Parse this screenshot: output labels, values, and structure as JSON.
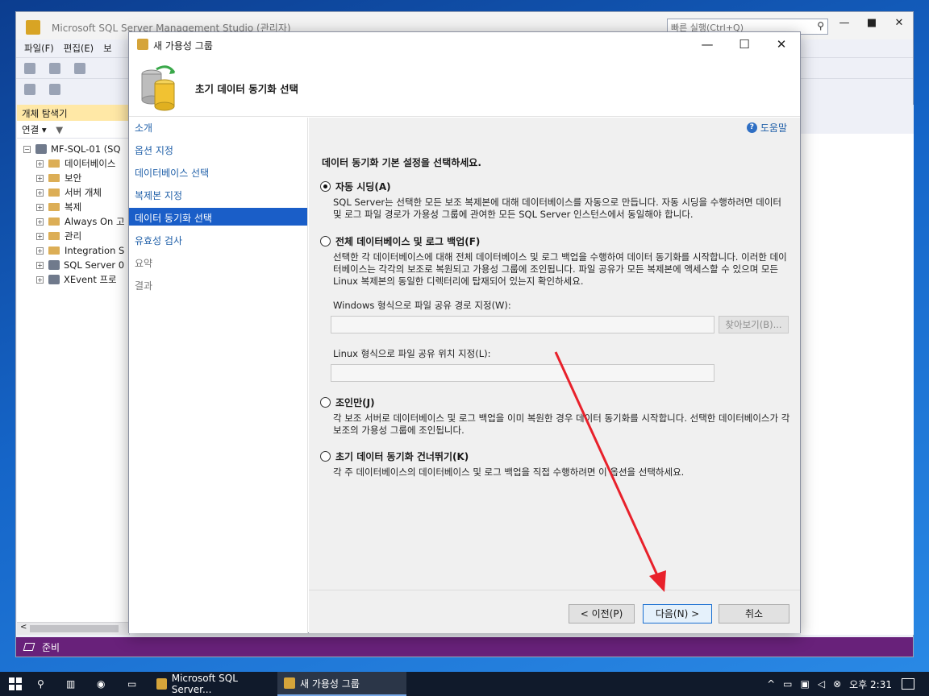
{
  "ssms": {
    "title": "Microsoft SQL Server Management Studio (관리자)",
    "quick_launch_placeholder": "빠른 실행(Ctrl+Q)",
    "menu": [
      "파일(F)",
      "편집(E)",
      "보"
    ],
    "object_explorer": {
      "header": "개체 탐색기",
      "connect_label": "연결",
      "server": "MF-SQL-01 (SQ",
      "nodes": [
        "데이터베이스",
        "보안",
        "서버 개체",
        "복제",
        "Always On 고",
        "관리",
        "Integration S",
        "SQL Server 0",
        "XEvent 프로"
      ]
    },
    "status": "준비"
  },
  "dialog": {
    "title": "새 가용성 그룹",
    "heading": "초기 데이터 동기화 선택",
    "nav": [
      "소개",
      "옵션 지정",
      "데이터베이스 선택",
      "복제본 지정",
      "데이터 동기화 선택",
      "유효성 검사",
      "요약",
      "결과"
    ],
    "help": "도움말",
    "lead": "데이터 동기화 기본 설정을 선택하세요.",
    "options": [
      {
        "label": "자동 시딩(A)",
        "selected": true,
        "desc": "SQL Server는 선택한 모든 보조 복제본에 대해 데이터베이스를 자동으로 만듭니다. 자동 시딩을 수행하려면 데이터 및 로그 파일 경로가 가용성 그룹에 관여한 모든 SQL Server 인스턴스에서 동일해야 합니다."
      },
      {
        "label": "전체 데이터베이스 및 로그 백업(F)",
        "selected": false,
        "desc": "선택한 각 데이터베이스에 대해 전체 데이터베이스 및 로그 백업을 수행하여 데이터 동기화를 시작합니다. 이러한 데이터베이스는 각각의 보조로 복원되고 가용성 그룹에 조인됩니다. 파일 공유가 모든 복제본에 액세스할 수 있으며 모든 Linux 복제본의 동일한 디렉터리에 탑재되어 있는지 확인하세요."
      },
      {
        "label": "조인만(J)",
        "selected": false,
        "desc": "각 보조 서버로 데이터베이스 및 로그 백업을 이미 복원한 경우 데이터 동기화를 시작합니다. 선택한 데이터베이스가 각 보조의 가용성 그룹에 조인됩니다."
      },
      {
        "label": "초기 데이터 동기화 건너뛰기(K)",
        "selected": false,
        "desc": "각 주 데이터베이스의 데이터베이스 및 로그 백업을 직접 수행하려면 이 옵션을 선택하세요."
      }
    ],
    "windows_share_label": "Windows 형식으로 파일 공유 경로 지정(W):",
    "windows_share_value": "",
    "browse_label": "찾아보기(B)...",
    "linux_share_label": "Linux 형식으로 파일 공유 위치 지정(L):",
    "linux_share_value": "",
    "buttons": {
      "prev": "< 이전(P)",
      "next": "다음(N) >",
      "cancel": "취소"
    }
  },
  "taskbar": {
    "tasks": [
      "Microsoft SQL Server...",
      "새 가용성 그룹"
    ],
    "clock": "오후 2:31"
  },
  "colors": {
    "accent": "#1a5ec8",
    "status_bar": "#68217a",
    "annotation_arrow": "#e8212b"
  }
}
